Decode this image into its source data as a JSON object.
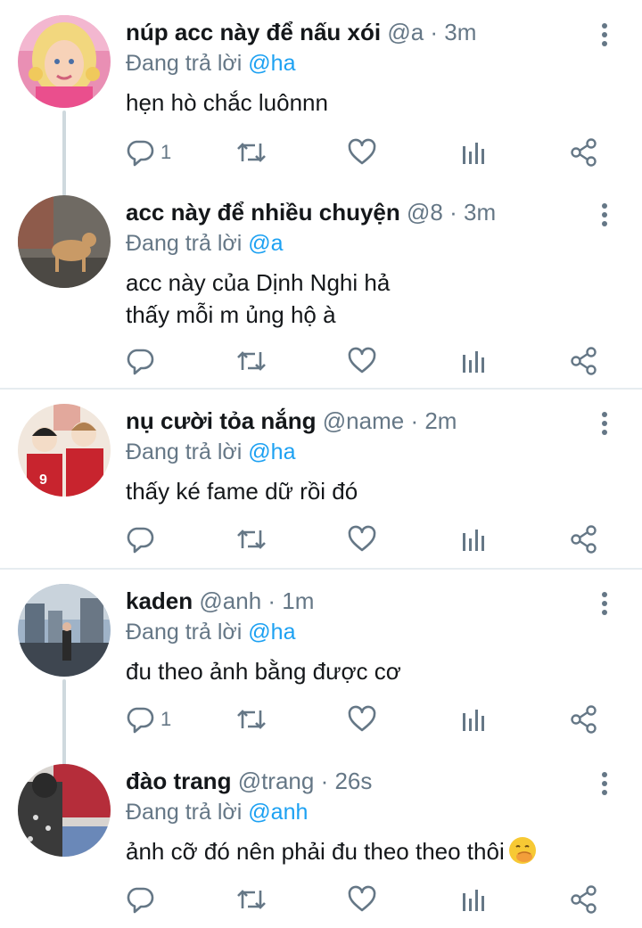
{
  "tweets": [
    {
      "name": "núp acc này để nấu xói",
      "handle": "@a",
      "time": "· 3m",
      "reply_prefix": "Đang trả lời",
      "reply_to": "@ha",
      "text": "hẹn hò chắc luônnn",
      "reply_count": "1",
      "avatar": "avatar-blonde-doll"
    },
    {
      "name": "acc này để nhiều chuyện",
      "handle": "@8",
      "time": "· 3m",
      "reply_prefix": "Đang trả lời",
      "reply_to": "@a",
      "text": "acc này của Dịnh Nghi hả\nthấy mỗi m ủng hộ à",
      "reply_count": "",
      "avatar": "avatar-dog"
    },
    {
      "name": "nụ cười tỏa nắng",
      "handle": "@name",
      "time": "· 2m",
      "reply_prefix": "Đang trả lời",
      "reply_to": "@ha",
      "text": "thấy ké fame dữ rồi đó",
      "reply_count": "",
      "avatar": "avatar-anime-players"
    },
    {
      "name": "kaden",
      "handle": "@anh",
      "time": "· 1m",
      "reply_prefix": "Đang trả lời",
      "reply_to": "@ha",
      "text": "đu theo ảnh bằng được cơ",
      "reply_count": "1",
      "avatar": "avatar-city-street"
    },
    {
      "name": "đào trang",
      "handle": "@trang",
      "time": "· 26s",
      "reply_prefix": "Đang trả lời",
      "reply_to": "@anh",
      "text": "ảnh cỡ đó nên phải đu theo theo thôi",
      "text_emoji": "hand-over-mouth-emoji",
      "reply_count": "",
      "avatar": "avatar-person-bag"
    }
  ],
  "icons": {
    "reply": "reply-icon",
    "retweet": "retweet-icon",
    "like": "heart-icon",
    "stats": "bar-chart-icon",
    "share": "share-icon",
    "more": "more-vertical-icon"
  },
  "colors": {
    "mention": "#1da1f2",
    "secondary_text": "#657786",
    "primary_text": "#14171a",
    "divider": "#e6ecf0",
    "thread_line": "#cfd9de"
  }
}
